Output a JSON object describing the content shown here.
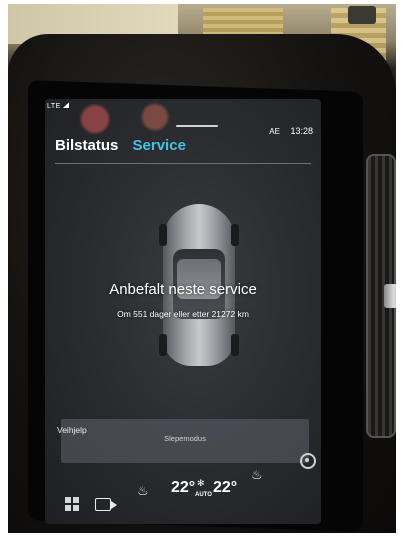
{
  "status_bar": {
    "network": "LTE",
    "locale": "AE",
    "time": "13:28"
  },
  "tabs": [
    {
      "label": "Bilstatus",
      "active": false
    },
    {
      "label": "Service",
      "active": true
    }
  ],
  "colors": {
    "accent": "#45c2e8",
    "screen_bg": "#2b2d31"
  },
  "service": {
    "headline": "Anbefalt neste service",
    "detail": "Om 551 dager eller etter 21272 km"
  },
  "roadside": {
    "label": "Veihjelp",
    "button_label": "Slepemodus"
  },
  "climate": {
    "temp_left": "22°",
    "temp_right": "22°",
    "fan_label": "AUTO"
  },
  "icons": [
    "home-grid-icon",
    "camera-icon",
    "seat-heat-left-icon",
    "fan-icon",
    "seat-heat-right-icon",
    "settings-icon"
  ]
}
